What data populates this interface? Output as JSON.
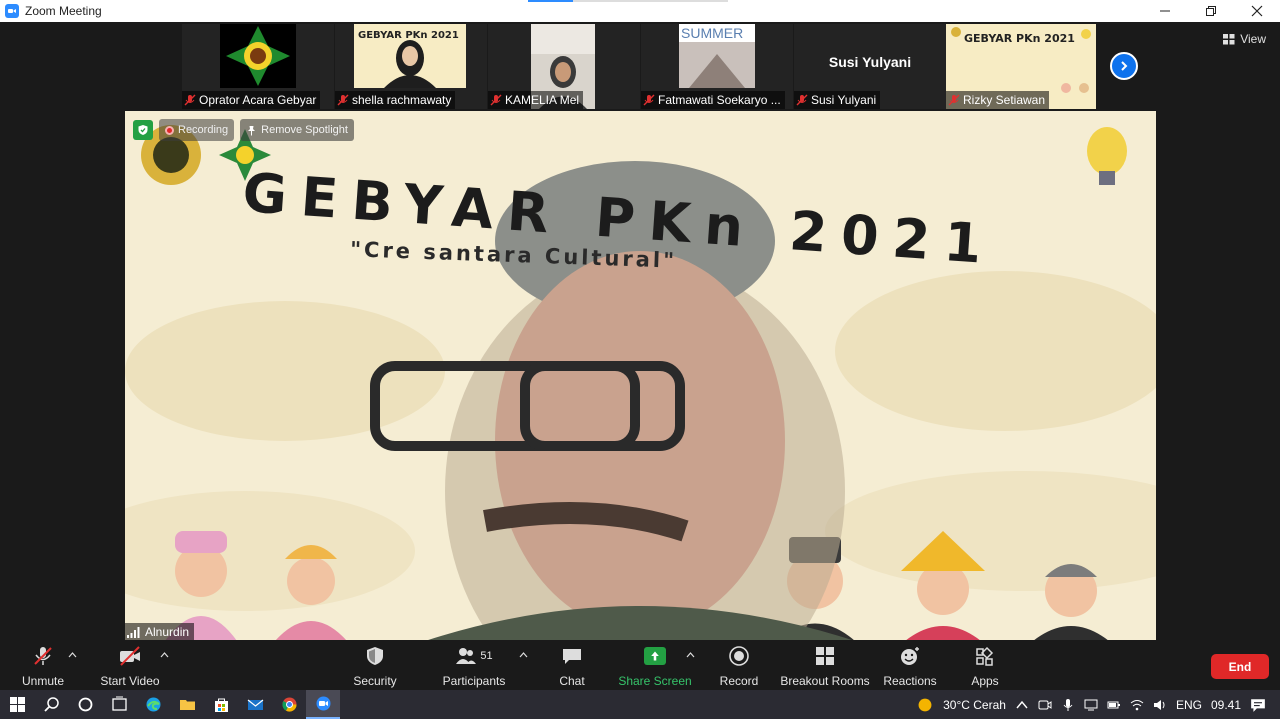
{
  "window": {
    "title": "Zoom Meeting",
    "accent": "#2d8cff"
  },
  "view_button": {
    "label": "View"
  },
  "thumbnails": [
    {
      "name": "Oprator Acara Gebyar",
      "muted": true
    },
    {
      "name": "shella rachmawaty",
      "muted": true
    },
    {
      "name": "KAMELIA Mel",
      "muted": true
    },
    {
      "name": "Fatmawati Soekaryo ...",
      "muted": true,
      "pic_text": "SUMMER"
    },
    {
      "name": "Susi Yulyani",
      "muted": true,
      "big_name": "Susi Yulyani"
    },
    {
      "name": "Rizky Setiawan",
      "muted": true
    }
  ],
  "main_video": {
    "bg_title": "GEBYAR PKn 2021",
    "bg_subtitle": "\"Cre          santara Cultural\"",
    "recording_label": "Recording",
    "spotlight_label": "Remove Spotlight",
    "speaker_name": "Alnurdin",
    "shield_color": "#23a043"
  },
  "toolbar": {
    "unmute": "Unmute",
    "start_video": "Start Video",
    "security": "Security",
    "participants": "Participants",
    "participants_count": "51",
    "chat": "Chat",
    "share_screen": "Share Screen",
    "record": "Record",
    "breakout_rooms": "Breakout Rooms",
    "reactions": "Reactions",
    "apps": "Apps",
    "end": "End",
    "end_color": "#e02828",
    "share_color": "#23a043"
  },
  "taskbar": {
    "weather": "30°C  Cerah",
    "language": "ENG",
    "time": "09.41"
  }
}
